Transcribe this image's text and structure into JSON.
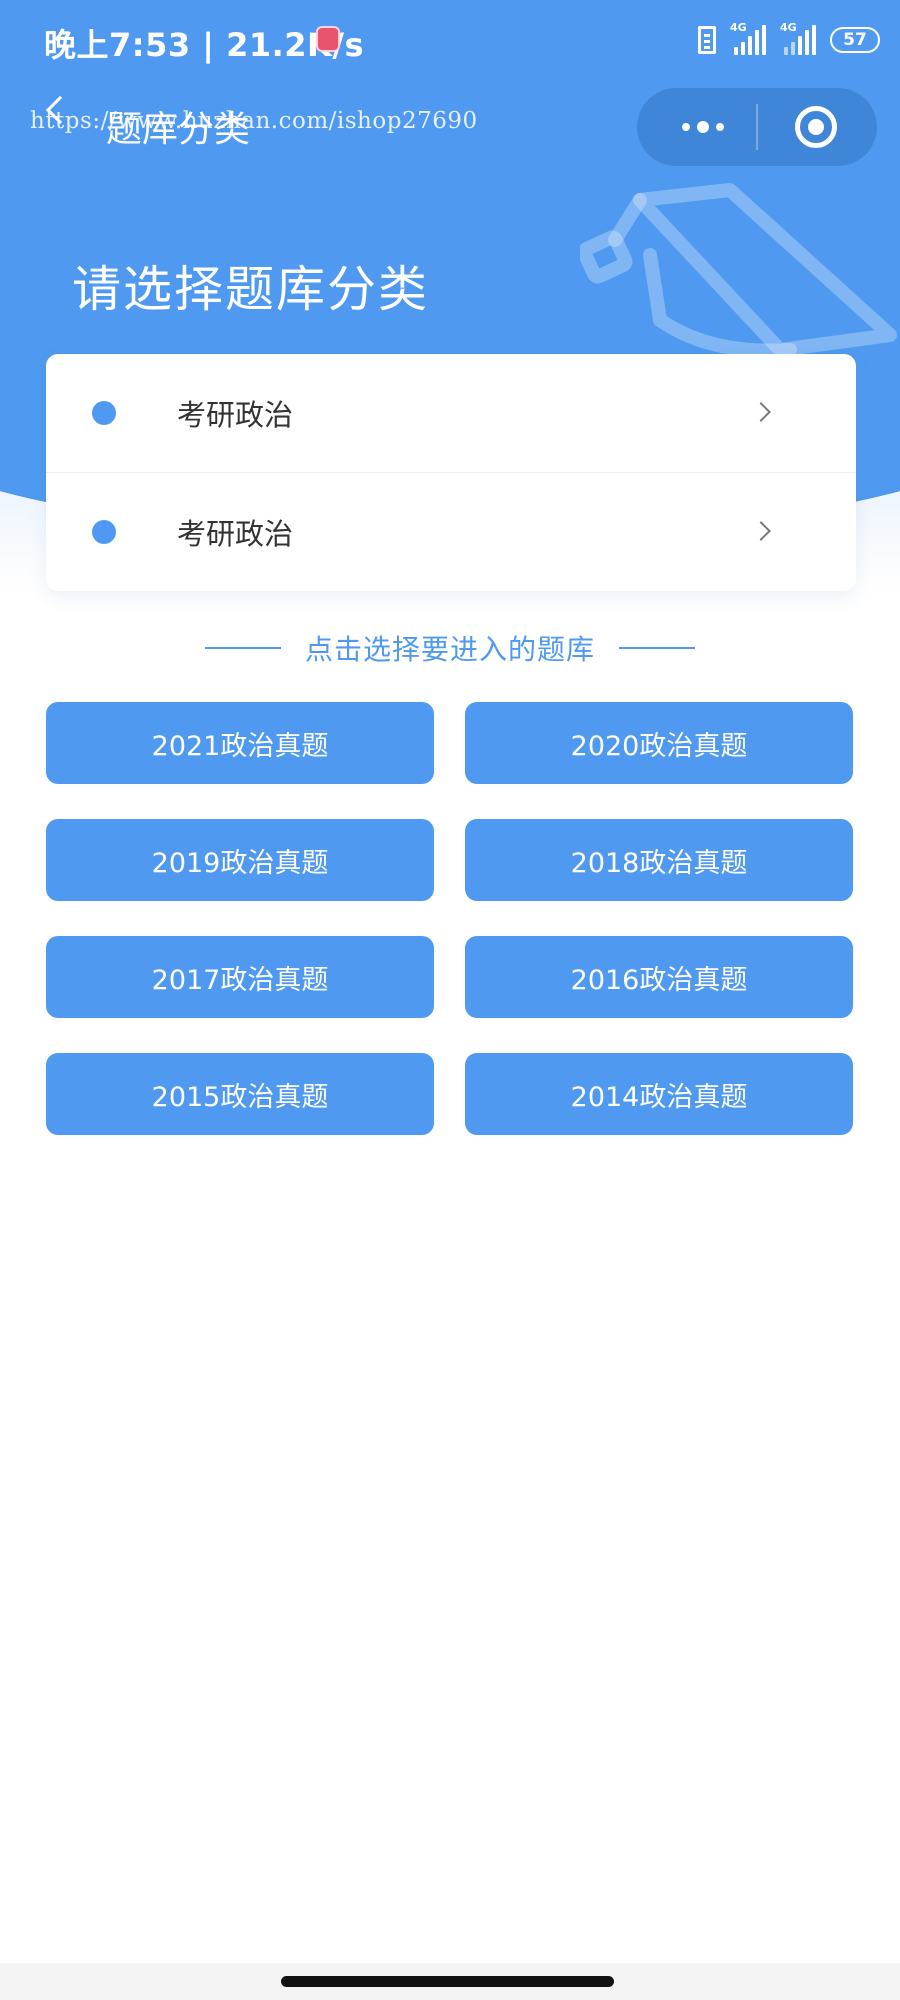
{
  "status_bar": {
    "time": "晚上7:53 | 21.2K/s",
    "network_tag_1": "4G",
    "network_tag_2": "4G",
    "battery": "57"
  },
  "nav": {
    "title": "题库分类",
    "watermark": "https://www.huzhan.com/ishop27690"
  },
  "hero": {
    "heading": "请选择题库分类"
  },
  "categories": [
    {
      "label": "考研政治"
    },
    {
      "label": "考研政治"
    }
  ],
  "section": {
    "title": "点击选择要进入的题库"
  },
  "banks": [
    {
      "label": "2021政治真题"
    },
    {
      "label": "2020政治真题"
    },
    {
      "label": "2019政治真题"
    },
    {
      "label": "2018政治真题"
    },
    {
      "label": "2017政治真题"
    },
    {
      "label": "2016政治真题"
    },
    {
      "label": "2015政治真题"
    },
    {
      "label": "2014政治真题"
    }
  ],
  "colors": {
    "primary": "#4f9af0",
    "capsule": "#3f86d8",
    "text": "#333333",
    "section_text": "#4f9af0"
  }
}
